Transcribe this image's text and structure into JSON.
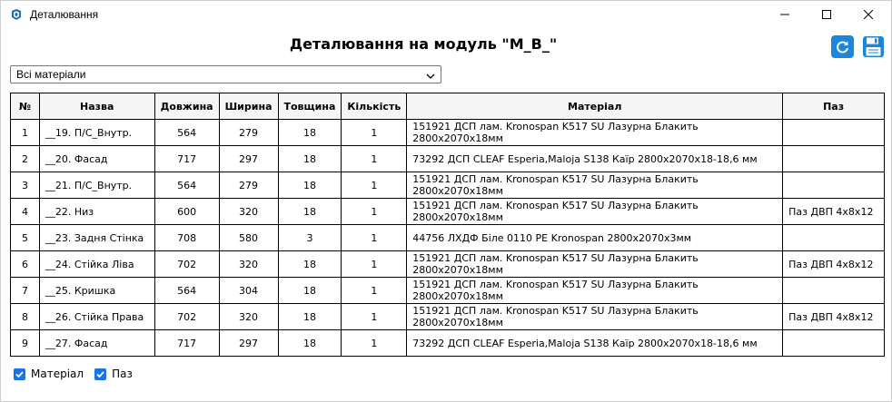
{
  "window": {
    "title": "Деталювання",
    "icon": "sketchup-icon"
  },
  "heading": "Деталювання на модуль \"M_B_\"",
  "toolbar": {
    "refresh_icon": "refresh-icon",
    "save_icon": "save-disk-icon",
    "accent": "#1e86d8"
  },
  "filter": {
    "selected": "Всі матеріали"
  },
  "table": {
    "headers": [
      "№",
      "Назва",
      "Довжина",
      "Ширина",
      "Товщина",
      "Кількість",
      "Матеріал",
      "Паз"
    ],
    "rows": [
      [
        "1",
        "__19. П/С_Внутр.",
        "564",
        "279",
        "18",
        "1",
        "151921 ДСП лам. Kronospan K517 SU Лазурна Блакить 2800х2070х18мм",
        ""
      ],
      [
        "2",
        "__20. Фасад",
        "717",
        "297",
        "18",
        "1",
        "73292 ДСП CLEAF Esperia,Maloja S138 Каїр 2800х2070х18-18,6 мм",
        ""
      ],
      [
        "3",
        "__21. П/С_Внутр.",
        "564",
        "279",
        "18",
        "1",
        "151921 ДСП лам. Kronospan K517 SU Лазурна Блакить 2800х2070х18мм",
        ""
      ],
      [
        "4",
        "__22. Низ",
        "600",
        "320",
        "18",
        "1",
        "151921 ДСП лам. Kronospan K517 SU Лазурна Блакить 2800х2070х18мм",
        "Паз ДВП 4x8x12"
      ],
      [
        "5",
        "__23. Задня Стінка",
        "708",
        "580",
        "3",
        "1",
        "44756 ЛХДФ Біле 0110 PE Kronospan 2800х2070х3мм",
        ""
      ],
      [
        "6",
        "__24. Стійка Ліва",
        "702",
        "320",
        "18",
        "1",
        "151921 ДСП лам. Kronospan K517 SU Лазурна Блакить 2800х2070х18мм",
        "Паз ДВП 4x8x12"
      ],
      [
        "7",
        "__25. Кришка",
        "564",
        "304",
        "18",
        "1",
        "151921 ДСП лам. Kronospan K517 SU Лазурна Блакить 2800х2070х18мм",
        ""
      ],
      [
        "8",
        "__26. Стійка Права",
        "702",
        "320",
        "18",
        "1",
        "151921 ДСП лам. Kronospan K517 SU Лазурна Блакить 2800х2070х18мм",
        "Паз ДВП 4x8x12"
      ],
      [
        "9",
        "__27. Фасад",
        "717",
        "297",
        "18",
        "1",
        "73292 ДСП CLEAF Esperia,Maloja S138 Каїр 2800х2070х18-18,6 мм",
        ""
      ]
    ]
  },
  "options": {
    "material_label": "Матеріал",
    "material_checked": true,
    "groove_label": "Паз",
    "groove_checked": true
  }
}
